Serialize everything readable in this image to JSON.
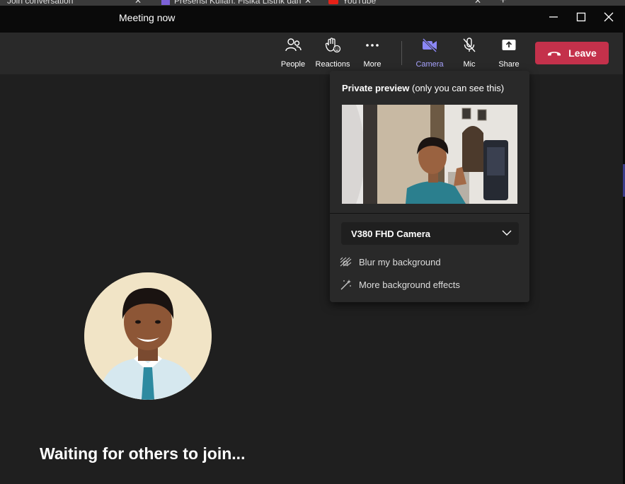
{
  "browser_tabs": [
    {
      "label": "Join conversation"
    },
    {
      "label": "Presensi Kuliah: Fisika Listrik dan"
    },
    {
      "label": "YouTube"
    }
  ],
  "window": {
    "title": "Meeting now"
  },
  "toolbar": {
    "people": "People",
    "reactions": "Reactions",
    "more": "More",
    "camera": "Camera",
    "mic": "Mic",
    "share": "Share",
    "leave": "Leave",
    "accent_color": "#a8a4ff",
    "leave_color": "#c4314b"
  },
  "preview_panel": {
    "heading_bold": "Private preview",
    "heading_rest": " (only you can see this)",
    "camera_device": "V380 FHD Camera",
    "blur_option": "Blur my background",
    "effects_option": "More background effects"
  },
  "stage": {
    "waiting_text": "Waiting for others to join..."
  }
}
